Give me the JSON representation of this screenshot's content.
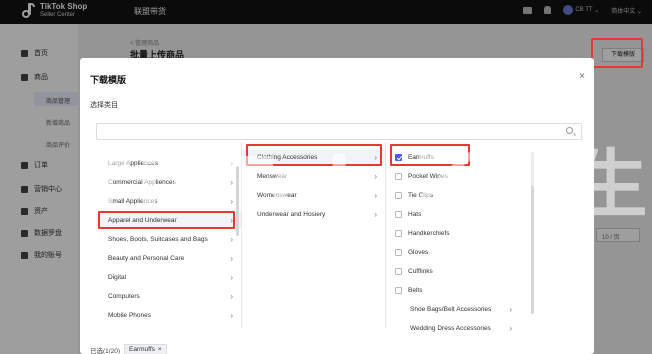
{
  "topbar": {
    "logo_line1": "TikTok Shop",
    "logo_line2": "Seller Center",
    "title": "联盟带货",
    "user": "CB TT",
    "lang": "简体中文"
  },
  "sidebar": {
    "items": [
      {
        "label": "首页"
      },
      {
        "label": "商品"
      },
      {
        "label": "订单"
      },
      {
        "label": "营销中心"
      },
      {
        "label": "资产"
      },
      {
        "label": "数据罗盘"
      },
      {
        "label": "我的账号"
      }
    ],
    "subitems": [
      {
        "label": "商品管理"
      },
      {
        "label": "新增商品"
      },
      {
        "label": "商品评价"
      }
    ]
  },
  "background": {
    "breadcrumb": "< 管理商品",
    "title": "批量上传商品",
    "download_button": "下载模版",
    "per_page": "10 / 页"
  },
  "modal": {
    "title": "下载模版",
    "close": "×",
    "subtitle": "选择类目",
    "column1": [
      {
        "label": "Large Appliences"
      },
      {
        "label": "Commercial Appliences"
      },
      {
        "label": "Small Appliences"
      },
      {
        "label": "Apparel and Underwear"
      },
      {
        "label": "Shoes, Boots, Suitcases and Bags"
      },
      {
        "label": "Beauty and Personal Care"
      },
      {
        "label": "Digital"
      },
      {
        "label": "Computers"
      },
      {
        "label": "Mobile Phones"
      }
    ],
    "column2": [
      {
        "label": "Clothing Accessories"
      },
      {
        "label": "Menswear"
      },
      {
        "label": "Womenswear"
      },
      {
        "label": "Underwear and Hosiery"
      }
    ],
    "column3": [
      {
        "label": "Earmuffs",
        "checked": true
      },
      {
        "label": "Pocket Wipes",
        "checked": false
      },
      {
        "label": "Tie Clips",
        "checked": false
      },
      {
        "label": "Hats",
        "checked": false
      },
      {
        "label": "Handkerchiefs",
        "checked": false
      },
      {
        "label": "Gloves",
        "checked": false
      },
      {
        "label": "Cufflinks",
        "checked": false
      },
      {
        "label": "Belts",
        "checked": false
      },
      {
        "label": "Shoe Bags/Belt Accessories"
      },
      {
        "label": "Wedding Dress Accessories"
      }
    ],
    "chevron": "›",
    "footer_label": "已选(1/20)",
    "selected_tag": "Earmuffs",
    "tag_remove": "×"
  },
  "watermark": "TikTok 乙先生"
}
